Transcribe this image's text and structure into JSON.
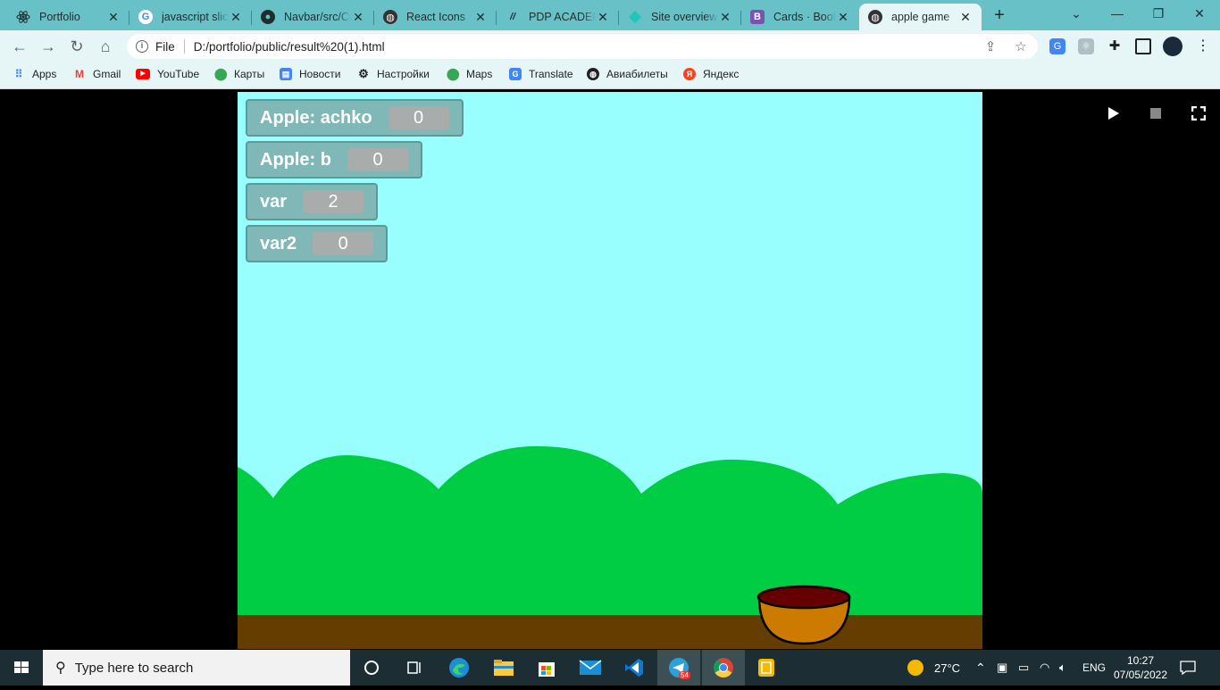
{
  "browser": {
    "tabs": [
      {
        "title": "Portfolio",
        "icon": "react-icon",
        "color": "#61dafb"
      },
      {
        "title": "javascript slice",
        "icon": "google-icon",
        "color": "#ffffff"
      },
      {
        "title": "Navbar/src/Co",
        "icon": "github-icon",
        "color": "#000000"
      },
      {
        "title": "React Icons",
        "icon": "globe-icon",
        "color": "#333333"
      },
      {
        "title": "PDP ACADEMY",
        "icon": "pdp-icon",
        "color": "#1aa260"
      },
      {
        "title": "Site overview",
        "icon": "netlify-icon",
        "color": "#20c6b7"
      },
      {
        "title": "Cards · Bootstrap",
        "icon": "bootstrap-icon",
        "color": "#7952b3"
      },
      {
        "title": "apple game",
        "icon": "globe-icon",
        "color": "#333333"
      }
    ],
    "active_tab": 7,
    "address": {
      "scheme": "File",
      "url": "D:/portfolio/public/result%20(1).html"
    },
    "bookmarks": [
      {
        "label": "Apps",
        "icon": "apps-grid-icon",
        "color": "#4285f4"
      },
      {
        "label": "Gmail",
        "icon": "gmail-icon",
        "color": "#ea4335"
      },
      {
        "label": "YouTube",
        "icon": "youtube-icon",
        "color": "#ff0000"
      },
      {
        "label": "Карты",
        "icon": "maps-pin-icon",
        "color": "#34a853"
      },
      {
        "label": "Новости",
        "icon": "news-icon",
        "color": "#4285f4"
      },
      {
        "label": "Настройки",
        "icon": "gear-icon",
        "color": "#202124"
      },
      {
        "label": "Maps",
        "icon": "maps-pin-icon",
        "color": "#34a853"
      },
      {
        "label": "Translate",
        "icon": "translate-icon",
        "color": "#4285f4"
      },
      {
        "label": "Авиабилеты",
        "icon": "globe-icon",
        "color": "#202124"
      },
      {
        "label": "Яндекс",
        "icon": "yandex-icon",
        "color": "#fc3f1d"
      }
    ]
  },
  "game": {
    "monitors": [
      {
        "label": "Apple: achko",
        "value": "0"
      },
      {
        "label": "Apple: b",
        "value": "0"
      },
      {
        "label": "var",
        "value": "2"
      },
      {
        "label": "var2",
        "value": "0"
      }
    ],
    "colors": {
      "sky": "#99fffe",
      "bushes": "#00cc44",
      "ground": "#663d00",
      "basket": "#cc7a00",
      "basket_inside": "#660000"
    }
  },
  "taskbar": {
    "search_placeholder": "Type here to search",
    "weather": "27°C",
    "language": "ENG",
    "time": "10:27",
    "date": "07/05/2022",
    "telegram_badge": "54"
  }
}
